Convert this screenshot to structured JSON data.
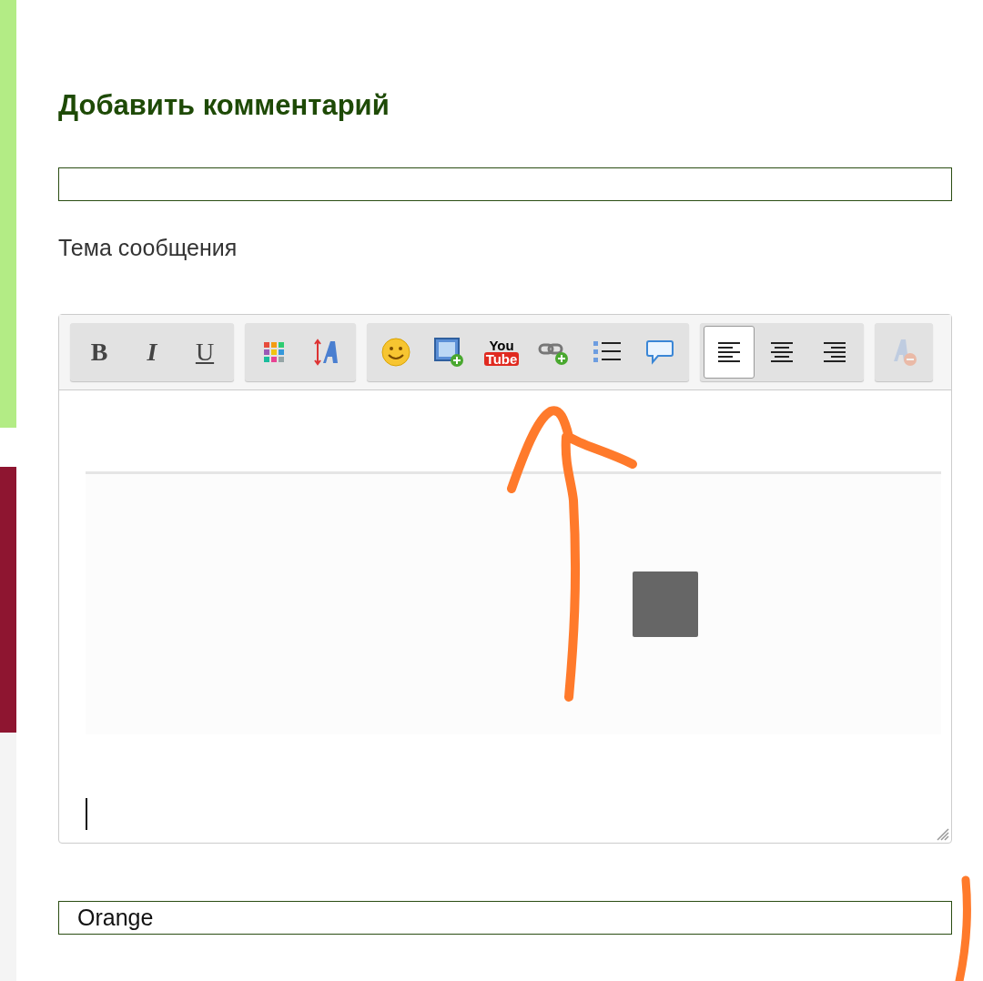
{
  "heading": "Добавить комментарий",
  "subject_label": "Тема сообщения",
  "editor": {
    "toolbar": [
      {
        "buttons": [
          {
            "kind": "bold",
            "label": "B",
            "selected": false,
            "disabled": false
          },
          {
            "kind": "italic",
            "label": "I",
            "selected": false,
            "disabled": false
          },
          {
            "kind": "underline",
            "label": "U",
            "selected": false,
            "disabled": false
          }
        ]
      },
      {
        "buttons": [
          {
            "kind": "color",
            "selected": false,
            "disabled": false
          },
          {
            "kind": "font-size",
            "selected": false,
            "disabled": false
          }
        ]
      },
      {
        "buttons": [
          {
            "kind": "smiley",
            "selected": false,
            "disabled": false
          },
          {
            "kind": "image",
            "selected": false,
            "disabled": false
          },
          {
            "kind": "youtube",
            "label_top": "You",
            "label_bottom": "Tube",
            "selected": false,
            "disabled": false
          },
          {
            "kind": "link",
            "selected": false,
            "disabled": false
          },
          {
            "kind": "list",
            "selected": false,
            "disabled": false
          },
          {
            "kind": "quote",
            "selected": false,
            "disabled": false
          }
        ]
      },
      {
        "buttons": [
          {
            "kind": "align-left",
            "selected": true,
            "disabled": false
          },
          {
            "kind": "align-center",
            "selected": false,
            "disabled": false
          },
          {
            "kind": "align-right",
            "selected": false,
            "disabled": false
          }
        ]
      },
      {
        "buttons": [
          {
            "kind": "clear-format",
            "selected": false,
            "disabled": true
          }
        ]
      }
    ]
  },
  "name_field": {
    "value": "Orange"
  }
}
